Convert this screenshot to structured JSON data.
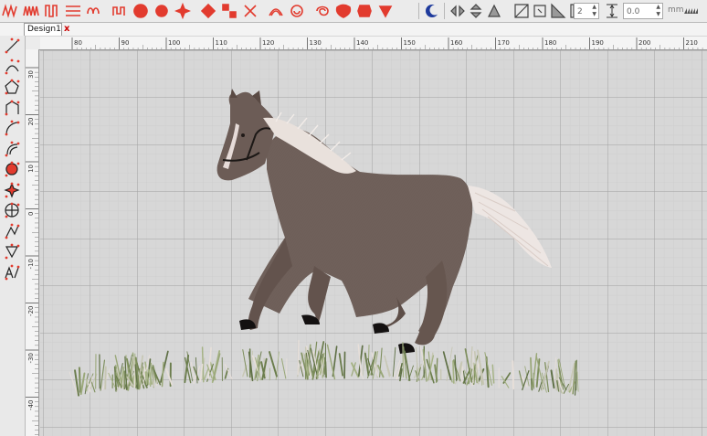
{
  "toolbar": {
    "stitch_tools": [
      "zigzag-icon",
      "wave-fill-icon",
      "triangle-fill-icon",
      "column-fill-icon",
      "loop-fill-icon",
      "meander-fill-icon",
      "circle-pattern-icon",
      "donut-icon",
      "flower-icon",
      "diamond-fill-icon",
      "diamond-grid-icon",
      "cross-fill-icon",
      "arc-fill-icon",
      "spiral-icon",
      "swirl-icon",
      "ornament-fill-icon",
      "lace-fill-icon",
      "motif-fill-icon"
    ],
    "color_tool": "crescent-color-icon",
    "transform_tools": [
      "mirror-horizontal-icon",
      "mirror-vertical-icon",
      "flip-icon",
      "rotate-icon",
      "grid-align-icon",
      "distribute-icon",
      "spacing-icon"
    ],
    "spin_value": "2",
    "spacing_value": "0.0",
    "unit": "mm",
    "accent": "#e23b2e"
  },
  "tab": {
    "label": "Design1",
    "close": "x"
  },
  "left_tools": [
    "line-tool-icon",
    "arc-tool-icon",
    "polygon-tool-icon",
    "shape-tool-icon",
    "curve-tool-icon",
    "satin-tool-icon",
    "circle-tool-icon",
    "star-tool-icon",
    "wheel-tool-icon",
    "node-tool-icon",
    "split-tool-icon",
    "lettering-tool-icon"
  ],
  "ruler": {
    "h_labels": [
      "80",
      "90",
      "100",
      "110",
      "120",
      "130",
      "140",
      "150",
      "160",
      "170",
      "180",
      "190",
      "200",
      "210"
    ],
    "v_labels": [
      "30",
      "20",
      "10",
      "0",
      "-10",
      "-20",
      "-30",
      "-40"
    ]
  },
  "canvas": {
    "background": "#d7d7d7",
    "grid_color": "#a7a7a7",
    "design": "embroidered-horse-on-grass"
  }
}
